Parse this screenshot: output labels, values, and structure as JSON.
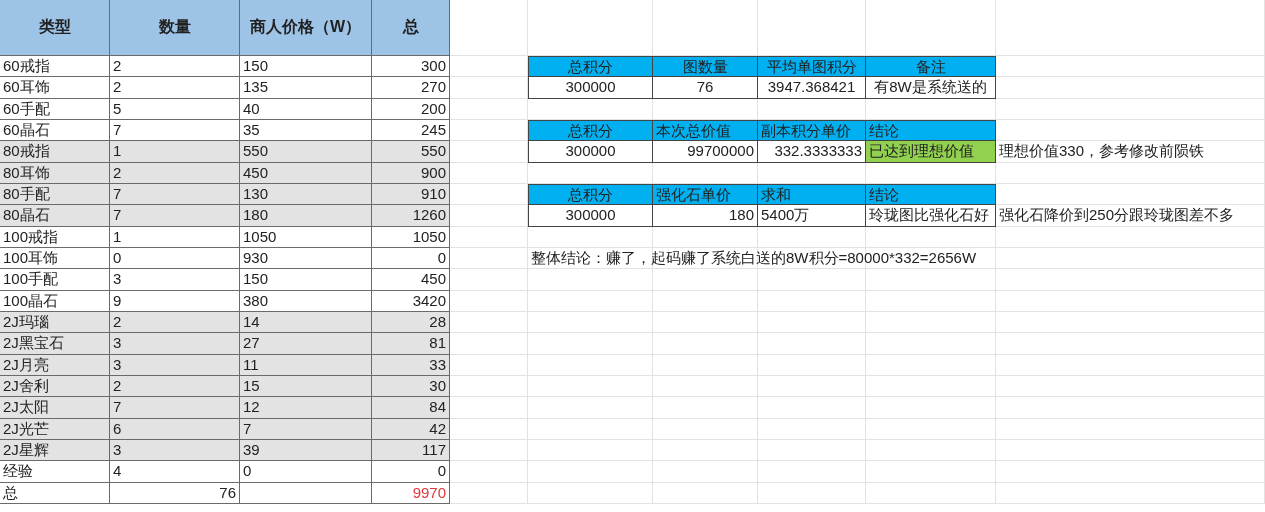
{
  "items_table": {
    "columns": [
      "类型",
      "数量",
      "商人价格（W）",
      "总"
    ],
    "rows": [
      {
        "cells": [
          "60戒指",
          "2",
          "150",
          "300"
        ],
        "shaded": false
      },
      {
        "cells": [
          "60耳饰",
          "2",
          "135",
          "270"
        ],
        "shaded": false
      },
      {
        "cells": [
          "60手配",
          "5",
          "40",
          "200"
        ],
        "shaded": false
      },
      {
        "cells": [
          "60晶石",
          "7",
          "35",
          "245"
        ],
        "shaded": false
      },
      {
        "cells": [
          "80戒指",
          "1",
          "550",
          "550"
        ],
        "shaded": true
      },
      {
        "cells": [
          "80耳饰",
          "2",
          "450",
          "900"
        ],
        "shaded": true
      },
      {
        "cells": [
          "80手配",
          "7",
          "130",
          "910"
        ],
        "shaded": true
      },
      {
        "cells": [
          "80晶石",
          "7",
          "180",
          "1260"
        ],
        "shaded": true
      },
      {
        "cells": [
          "100戒指",
          "1",
          "1050",
          "1050"
        ],
        "shaded": false
      },
      {
        "cells": [
          "100耳饰",
          "0",
          "930",
          "0"
        ],
        "shaded": false
      },
      {
        "cells": [
          "100手配",
          "3",
          "150",
          "450"
        ],
        "shaded": false
      },
      {
        "cells": [
          "100晶石",
          "9",
          "380",
          "3420"
        ],
        "shaded": false
      },
      {
        "cells": [
          "2J玛瑙",
          "2",
          "14",
          "28"
        ],
        "shaded": true
      },
      {
        "cells": [
          "2J黑宝石",
          "3",
          "27",
          "81"
        ],
        "shaded": true
      },
      {
        "cells": [
          "2J月亮",
          "3",
          "11",
          "33"
        ],
        "shaded": true
      },
      {
        "cells": [
          "2J舍利",
          "2",
          "15",
          "30"
        ],
        "shaded": true
      },
      {
        "cells": [
          "2J太阳",
          "7",
          "12",
          "84"
        ],
        "shaded": true
      },
      {
        "cells": [
          "2J光芒",
          "6",
          "7",
          "42"
        ],
        "shaded": true
      },
      {
        "cells": [
          "2J星辉",
          "3",
          "39",
          "117"
        ],
        "shaded": true
      },
      {
        "cells": [
          "经验",
          "4",
          "0",
          "0"
        ],
        "shaded": false
      }
    ],
    "total_row": {
      "label": "总",
      "count": "76",
      "total": "9970"
    }
  },
  "summary_tables": [
    {
      "centered": true,
      "columns": [
        "总积分",
        "图数量",
        "平均单图积分",
        "备注"
      ],
      "values": [
        {
          "text": "300000",
          "kind": "number"
        },
        {
          "text": "76",
          "kind": "number"
        },
        {
          "text": "3947.368421",
          "kind": "number"
        },
        {
          "text": "有8W是系统送的",
          "kind": "text",
          "highlighted": false
        }
      ]
    },
    {
      "centered": false,
      "columns": [
        "总积分",
        "本次总价值",
        "副本积分单价",
        "结论"
      ],
      "values": [
        {
          "text": "300000",
          "kind": "number"
        },
        {
          "text": "99700000",
          "kind": "number"
        },
        {
          "text": "332.3333333",
          "kind": "number"
        },
        {
          "text": "已达到理想价值",
          "kind": "text",
          "highlighted": true
        }
      ],
      "note": "理想价值330，参考修改前陨铁"
    },
    {
      "centered": false,
      "columns": [
        "总积分",
        "强化石单价",
        "求和",
        "结论"
      ],
      "values": [
        {
          "text": "300000",
          "kind": "number"
        },
        {
          "text": "180",
          "kind": "number"
        },
        {
          "text": "5400万",
          "kind": "text"
        },
        {
          "text": "玲珑图比强化石好",
          "kind": "text",
          "highlighted": false
        }
      ],
      "note": "强化石降价到250分跟玲珑图差不多"
    }
  ],
  "overall_conclusion": "整体结论：赚了，起码赚了系统白送的8W积分=80000*332=2656W"
}
